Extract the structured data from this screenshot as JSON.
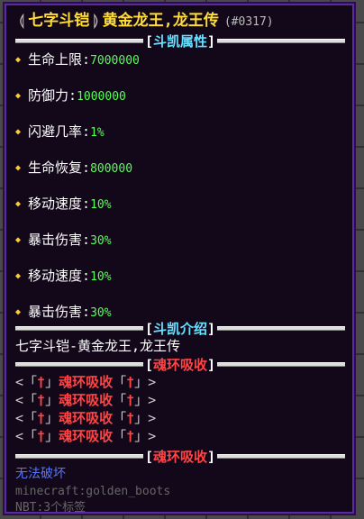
{
  "item": {
    "type_label": "七字斗铠",
    "name": "黄金龙王,龙王传",
    "id": "(#0317)"
  },
  "sections": {
    "attributes": "斗凯属性",
    "intro": "斗凯介绍",
    "ring": "魂环吸收"
  },
  "stats": [
    {
      "label": "生命上限:",
      "value": "7000000"
    },
    {
      "label": "防御力:",
      "value": "1000000"
    },
    {
      "label": "闪避几率:",
      "value": "1%"
    },
    {
      "label": "生命恢复:",
      "value": "800000"
    },
    {
      "label": "移动速度:",
      "value": "10%"
    },
    {
      "label": "暴击伤害:",
      "value": "30%"
    },
    {
      "label": "移动速度:",
      "value": "10%"
    },
    {
      "label": "暴击伤害:",
      "value": "30%"
    }
  ],
  "intro_text": "七字斗铠-黄金龙王,龙王传",
  "ring_rows": [
    {
      "left": "<「",
      "mid1": "†",
      "sep1": "」",
      "text": "魂环吸收",
      "sep2": "「",
      "mid2": "†",
      "right": "」>"
    },
    {
      "left": "<「",
      "mid1": "†",
      "sep1": "」",
      "text": "魂环吸收",
      "sep2": "「",
      "mid2": "†",
      "right": "」>"
    },
    {
      "left": "<「",
      "mid1": "†",
      "sep1": "」",
      "text": "魂环吸收",
      "sep2": "「",
      "mid2": "†",
      "right": "」>"
    },
    {
      "left": "<「",
      "mid1": "†",
      "sep1": "」",
      "text": "魂环吸收",
      "sep2": "「",
      "mid2": "†",
      "right": "」>"
    }
  ],
  "footer": {
    "unbreakable": "无法破坏",
    "item_id": "minecraft:golden_boots",
    "nbt": "NBT:3个标签"
  },
  "colors": {
    "title": "#ffdd33",
    "stat_value": "#55ff55",
    "section_attr": "#66e0ff",
    "section_ring": "#ff4444",
    "unbreakable": "#5577ff"
  },
  "icons": {
    "stat_bullet": "diamond-icon",
    "ring_symbol": "dagger-icon"
  }
}
